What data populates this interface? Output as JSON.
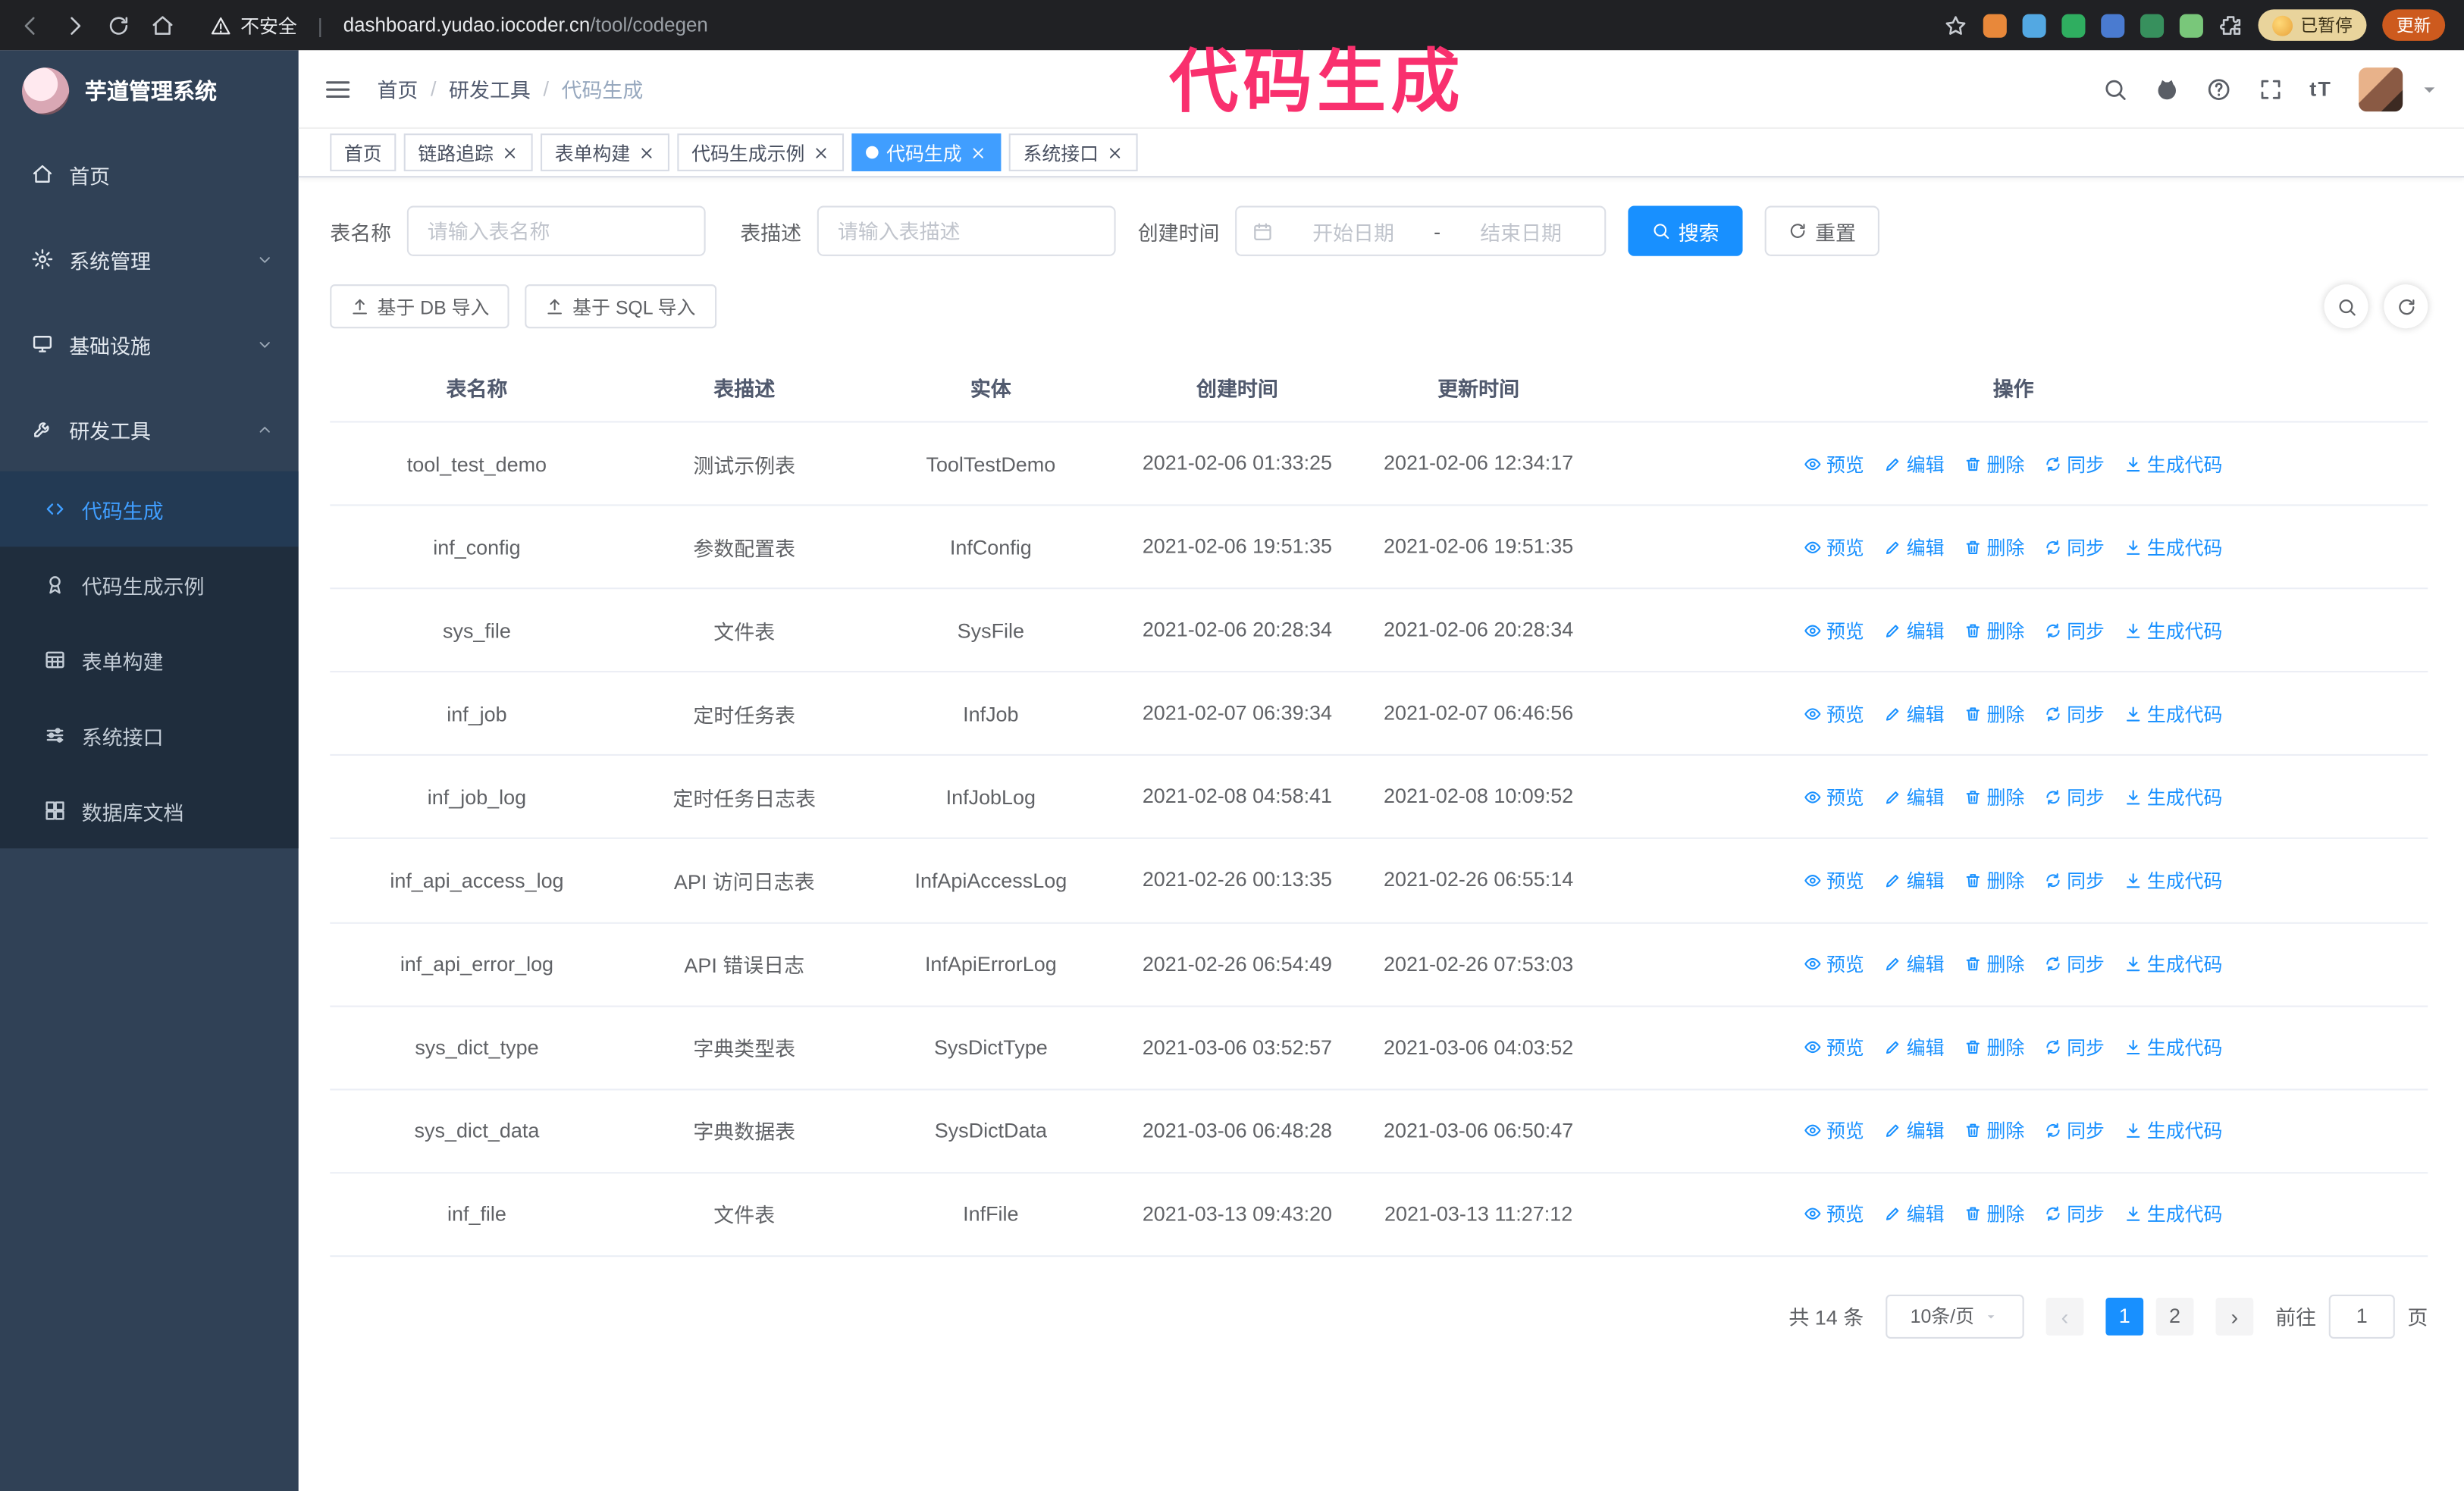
{
  "annotation": {
    "text": "代码生成",
    "color": "#f9306e"
  },
  "browser": {
    "insecure_label": "不安全",
    "url_host": "dashboard.yudao.iocoder.cn",
    "url_path": "/tool/codegen",
    "extension_colors": [
      "#e8883a",
      "#53a8e2",
      "#2fae60",
      "#4a7bd0",
      "#37905d",
      "#79c77a"
    ],
    "paused_badge": "已暂停",
    "update_button": "更新"
  },
  "sidebar": {
    "logo_title": "芋道管理系统",
    "items": [
      {
        "label": "首页"
      },
      {
        "label": "系统管理"
      },
      {
        "label": "基础设施"
      },
      {
        "label": "研发工具"
      }
    ],
    "subitems": [
      {
        "label": "代码生成",
        "active": true
      },
      {
        "label": "代码生成示例"
      },
      {
        "label": "表单构建"
      },
      {
        "label": "系统接口"
      },
      {
        "label": "数据库文档"
      }
    ]
  },
  "header": {
    "breadcrumb": [
      "首页",
      "研发工具",
      "代码生成"
    ]
  },
  "tabs": [
    {
      "label": "首页",
      "closable": false,
      "active": false
    },
    {
      "label": "链路追踪",
      "closable": true,
      "active": false
    },
    {
      "label": "表单构建",
      "closable": true,
      "active": false
    },
    {
      "label": "代码生成示例",
      "closable": true,
      "active": false
    },
    {
      "label": "代码生成",
      "closable": true,
      "active": true
    },
    {
      "label": "系统接口",
      "closable": true,
      "active": false
    }
  ],
  "filters": {
    "table_name_label": "表名称",
    "table_name_placeholder": "请输入表名称",
    "table_desc_label": "表描述",
    "table_desc_placeholder": "请输入表描述",
    "create_time_label": "创建时间",
    "date_start_placeholder": "开始日期",
    "date_separator": "-",
    "date_end_placeholder": "结束日期",
    "search_button": "搜索",
    "reset_button": "重置"
  },
  "toolbar": {
    "import_db_button": "基于 DB 导入",
    "import_sql_button": "基于 SQL 导入"
  },
  "table": {
    "columns": [
      "表名称",
      "表描述",
      "实体",
      "创建时间",
      "更新时间",
      "操作"
    ],
    "actions": [
      {
        "label": "预览",
        "icon": "eye-icon"
      },
      {
        "label": "编辑",
        "icon": "edit-icon"
      },
      {
        "label": "删除",
        "icon": "trash-icon"
      },
      {
        "label": "同步",
        "icon": "sync-icon"
      },
      {
        "label": "生成代码",
        "icon": "download-icon"
      }
    ],
    "rows": [
      {
        "name": "tool_test_demo",
        "desc": "测试示例表",
        "entity": "ToolTestDemo",
        "created": "2021-02-06 01:33:25",
        "updated": "2021-02-06 12:34:17"
      },
      {
        "name": "inf_config",
        "desc": "参数配置表",
        "entity": "InfConfig",
        "created": "2021-02-06 19:51:35",
        "updated": "2021-02-06 19:51:35"
      },
      {
        "name": "sys_file",
        "desc": "文件表",
        "entity": "SysFile",
        "created": "2021-02-06 20:28:34",
        "updated": "2021-02-06 20:28:34"
      },
      {
        "name": "inf_job",
        "desc": "定时任务表",
        "entity": "InfJob",
        "created": "2021-02-07 06:39:34",
        "updated": "2021-02-07 06:46:56"
      },
      {
        "name": "inf_job_log",
        "desc": "定时任务日志表",
        "entity": "InfJobLog",
        "created": "2021-02-08 04:58:41",
        "updated": "2021-02-08 10:09:52"
      },
      {
        "name": "inf_api_access_log",
        "desc": "API 访问日志表",
        "entity": "InfApiAccessLog",
        "created": "2021-02-26 00:13:35",
        "updated": "2021-02-26 06:55:14"
      },
      {
        "name": "inf_api_error_log",
        "desc": "API 错误日志",
        "entity": "InfApiErrorLog",
        "created": "2021-02-26 06:54:49",
        "updated": "2021-02-26 07:53:03"
      },
      {
        "name": "sys_dict_type",
        "desc": "字典类型表",
        "entity": "SysDictType",
        "created": "2021-03-06 03:52:57",
        "updated": "2021-03-06 04:03:52"
      },
      {
        "name": "sys_dict_data",
        "desc": "字典数据表",
        "entity": "SysDictData",
        "created": "2021-03-06 06:48:28",
        "updated": "2021-03-06 06:50:47"
      },
      {
        "name": "inf_file",
        "desc": "文件表",
        "entity": "InfFile",
        "created": "2021-03-13 09:43:20",
        "updated": "2021-03-13 11:27:12"
      }
    ]
  },
  "pagination": {
    "total": "共 14 条",
    "page_size": "10条/页",
    "pages": [
      "1",
      "2"
    ],
    "active_page": "1",
    "goto_label": "前往",
    "goto_value": "1",
    "page_label": "页"
  },
  "colors": {
    "accent_blue": "#1890ff",
    "menu_active_blue": "#409eff",
    "sidebar_bg": "#304156",
    "submenu_bg": "#1f2d3d"
  }
}
